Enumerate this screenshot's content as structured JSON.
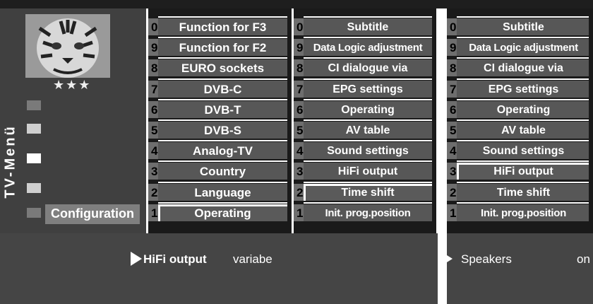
{
  "sidebar": {
    "vertical_title": "TV-Menü",
    "stars": "★★★",
    "config_label": "Configuration",
    "image_icon": "tiger-photo-icon"
  },
  "menu_level1": {
    "items": [
      {
        "num": "0",
        "label": "Function for F3"
      },
      {
        "num": "9",
        "label": "Function for F2"
      },
      {
        "num": "8",
        "label": "EURO sockets"
      },
      {
        "num": "7",
        "label": "DVB-C"
      },
      {
        "num": "6",
        "label": "DVB-T"
      },
      {
        "num": "5",
        "label": "DVB-S"
      },
      {
        "num": "4",
        "label": "Analog-TV"
      },
      {
        "num": "3",
        "label": "Country"
      },
      {
        "num": "2",
        "label": "Language"
      },
      {
        "num": "1",
        "label": "Operating"
      }
    ],
    "selected": "Operating"
  },
  "menu_level2": {
    "items": [
      {
        "num": "0",
        "label": "Subtitle"
      },
      {
        "num": "9",
        "label": "Data Logic adjustment"
      },
      {
        "num": "8",
        "label": "CI dialogue via"
      },
      {
        "num": "7",
        "label": "EPG settings"
      },
      {
        "num": "6",
        "label": "Operating"
      },
      {
        "num": "5",
        "label": "AV table"
      },
      {
        "num": "4",
        "label": "Sound settings"
      },
      {
        "num": "3",
        "label": "HiFi output"
      },
      {
        "num": "2",
        "label": "Time shift"
      },
      {
        "num": "1",
        "label": "Init. prog.position"
      }
    ],
    "selected": "Time shift"
  },
  "menu_level3": {
    "items": [
      {
        "num": "0",
        "label": "Subtitle"
      },
      {
        "num": "9",
        "label": "Data Logic adjustment"
      },
      {
        "num": "8",
        "label": "CI dialogue via"
      },
      {
        "num": "7",
        "label": "EPG settings"
      },
      {
        "num": "6",
        "label": "Operating"
      },
      {
        "num": "5",
        "label": "AV table"
      },
      {
        "num": "4",
        "label": "Sound settings"
      },
      {
        "num": "3",
        "label": "HiFi output"
      },
      {
        "num": "2",
        "label": "Time shift"
      },
      {
        "num": "1",
        "label": "Init. prog.position"
      }
    ],
    "selected": "HiFi output"
  },
  "info_bar_left": {
    "pointer_icon": "triangle-pointer-icon",
    "label": "HiFi output",
    "value": "variabe"
  },
  "info_bar_right": {
    "pointer_icon": "triangle-pointer-icon",
    "label": "Speakers",
    "value": "on"
  },
  "colors": {
    "menu_bg": "#1a1a1a",
    "cell": "#575757",
    "panel": "#3c3c3c",
    "highlight": "#ffffff"
  }
}
